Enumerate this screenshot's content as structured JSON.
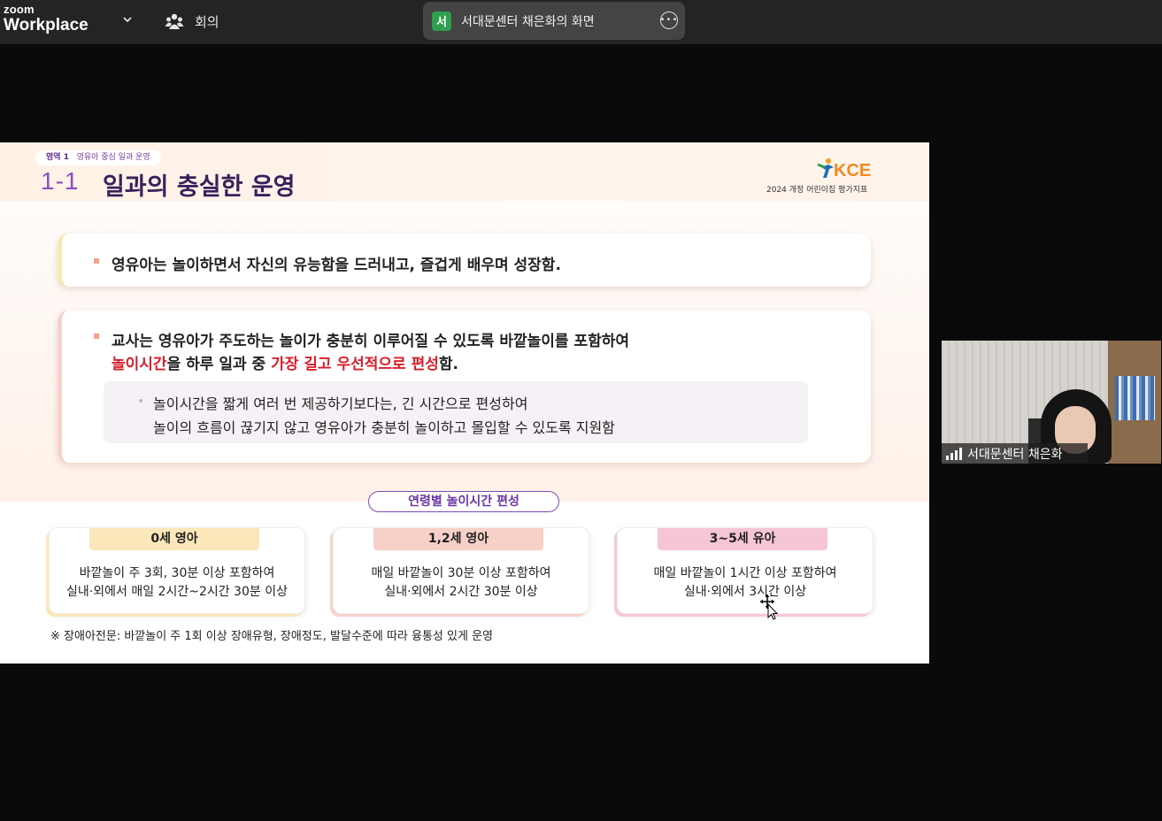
{
  "app": {
    "logo_small": "zoom",
    "logo_big": "Workplace",
    "meetings_label": "회의"
  },
  "share": {
    "avatar_letter": "서",
    "label": "서대문센터 채은화의 화면"
  },
  "slide": {
    "area_tag_strong": "영역 1",
    "area_tag_text": "영유아 중심 일과 운영",
    "number": "1-1",
    "title": "일과의 충실한 운영",
    "logo_text": "KCE",
    "logo_sub": "2024 개정 어린이집 평가지표",
    "card1_text": "영유아는 놀이하면서 자신의 유능함을 드러내고, 즐겁게 배우며 성장함.",
    "card2_line1": "교사는 영유아가 주도하는 놀이가 충분히 이루어질 수 있도록 바깥놀이를 포함하여",
    "card2_line2_red1": "놀이시간",
    "card2_line2_mid": "을 하루 일과 중 ",
    "card2_line2_red2": "가장 길고 우선적으로 편성",
    "card2_line2_end": "함.",
    "sub_line1": "놀이시간을 짧게 여러 번 제공하기보다는, 긴 시간으로 편성하여",
    "sub_line2": "놀이의 흐름이 끊기지 않고 영유아가 충분히 놀이하고 몰입할 수 있도록 지원함",
    "age_section_title": "연령별 놀이시간 편성",
    "age_cards": [
      {
        "head": "0세 영아",
        "line1": "바깥놀이 주 3회, 30분 이상 포함하여",
        "line2": "실내·외에서 매일 2시간~2시간 30분 이상"
      },
      {
        "head": "1,2세 영아",
        "line1": "매일 바깥놀이 30분 이상 포함하여",
        "line2": "실내·외에서 2시간 30분 이상"
      },
      {
        "head": "3~5세 유아",
        "line1": "매일 바깥놀이 1시간 이상 포함하여",
        "line2": "실내·외에서 3시간 이상"
      }
    ],
    "footnote": "※ 장애아전문: 바깥놀이 주 1회 이상 장애유형, 장애정도, 발달수준에 따라 융통성 있게 운영"
  },
  "participant": {
    "name": "서대문센터 채은화"
  },
  "colors": {
    "accent_red": "#d81e2b",
    "title_purple": "#3a1f5c",
    "share_avatar": "#2e9e4f"
  }
}
